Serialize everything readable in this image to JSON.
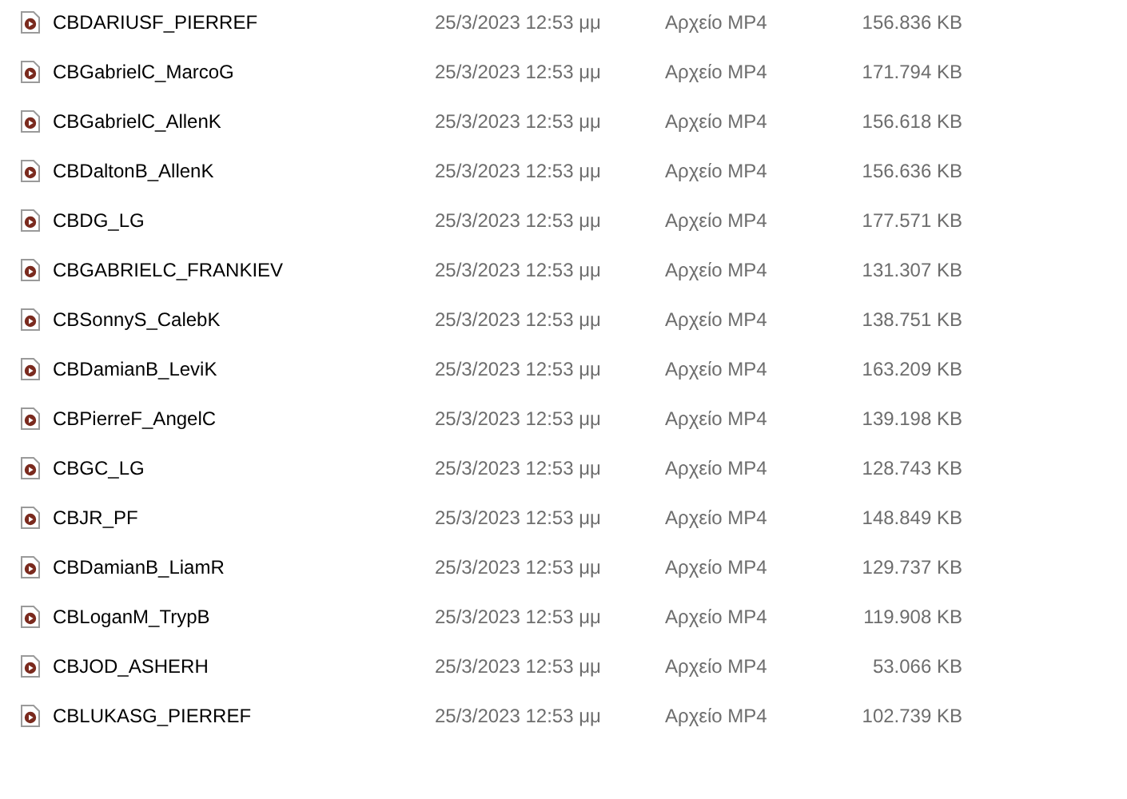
{
  "files": [
    {
      "name": "CBDARIUSF_PIERREF",
      "date": "25/3/2023 12:53 μμ",
      "type": "Αρχείο MP4",
      "size": "156.836 KB"
    },
    {
      "name": "CBGabrielC_MarcoG",
      "date": "25/3/2023 12:53 μμ",
      "type": "Αρχείο MP4",
      "size": "171.794 KB"
    },
    {
      "name": "CBGabrielC_AllenK",
      "date": "25/3/2023 12:53 μμ",
      "type": "Αρχείο MP4",
      "size": "156.618 KB"
    },
    {
      "name": "CBDaltonB_AllenK",
      "date": "25/3/2023 12:53 μμ",
      "type": "Αρχείο MP4",
      "size": "156.636 KB"
    },
    {
      "name": "CBDG_LG",
      "date": "25/3/2023 12:53 μμ",
      "type": "Αρχείο MP4",
      "size": "177.571 KB"
    },
    {
      "name": "CBGABRIELC_FRANKIEV",
      "date": "25/3/2023 12:53 μμ",
      "type": "Αρχείο MP4",
      "size": "131.307 KB"
    },
    {
      "name": "CBSonnyS_CalebK",
      "date": "25/3/2023 12:53 μμ",
      "type": "Αρχείο MP4",
      "size": "138.751 KB"
    },
    {
      "name": "CBDamianB_LeviK",
      "date": "25/3/2023 12:53 μμ",
      "type": "Αρχείο MP4",
      "size": "163.209 KB"
    },
    {
      "name": "CBPierreF_AngelC",
      "date": "25/3/2023 12:53 μμ",
      "type": "Αρχείο MP4",
      "size": "139.198 KB"
    },
    {
      "name": "CBGC_LG",
      "date": "25/3/2023 12:53 μμ",
      "type": "Αρχείο MP4",
      "size": "128.743 KB"
    },
    {
      "name": "CBJR_PF",
      "date": "25/3/2023 12:53 μμ",
      "type": "Αρχείο MP4",
      "size": "148.849 KB"
    },
    {
      "name": "CBDamianB_LiamR",
      "date": "25/3/2023 12:53 μμ",
      "type": "Αρχείο MP4",
      "size": "129.737 KB"
    },
    {
      "name": "CBLoganM_TrypB",
      "date": "25/3/2023 12:53 μμ",
      "type": "Αρχείο MP4",
      "size": "119.908 KB"
    },
    {
      "name": "CBJOD_ASHERH",
      "date": "25/3/2023 12:53 μμ",
      "type": "Αρχείο MP4",
      "size": "53.066 KB"
    },
    {
      "name": "CBLUKASG_PIERREF",
      "date": "25/3/2023 12:53 μμ",
      "type": "Αρχείο MP4",
      "size": "102.739 KB"
    }
  ]
}
